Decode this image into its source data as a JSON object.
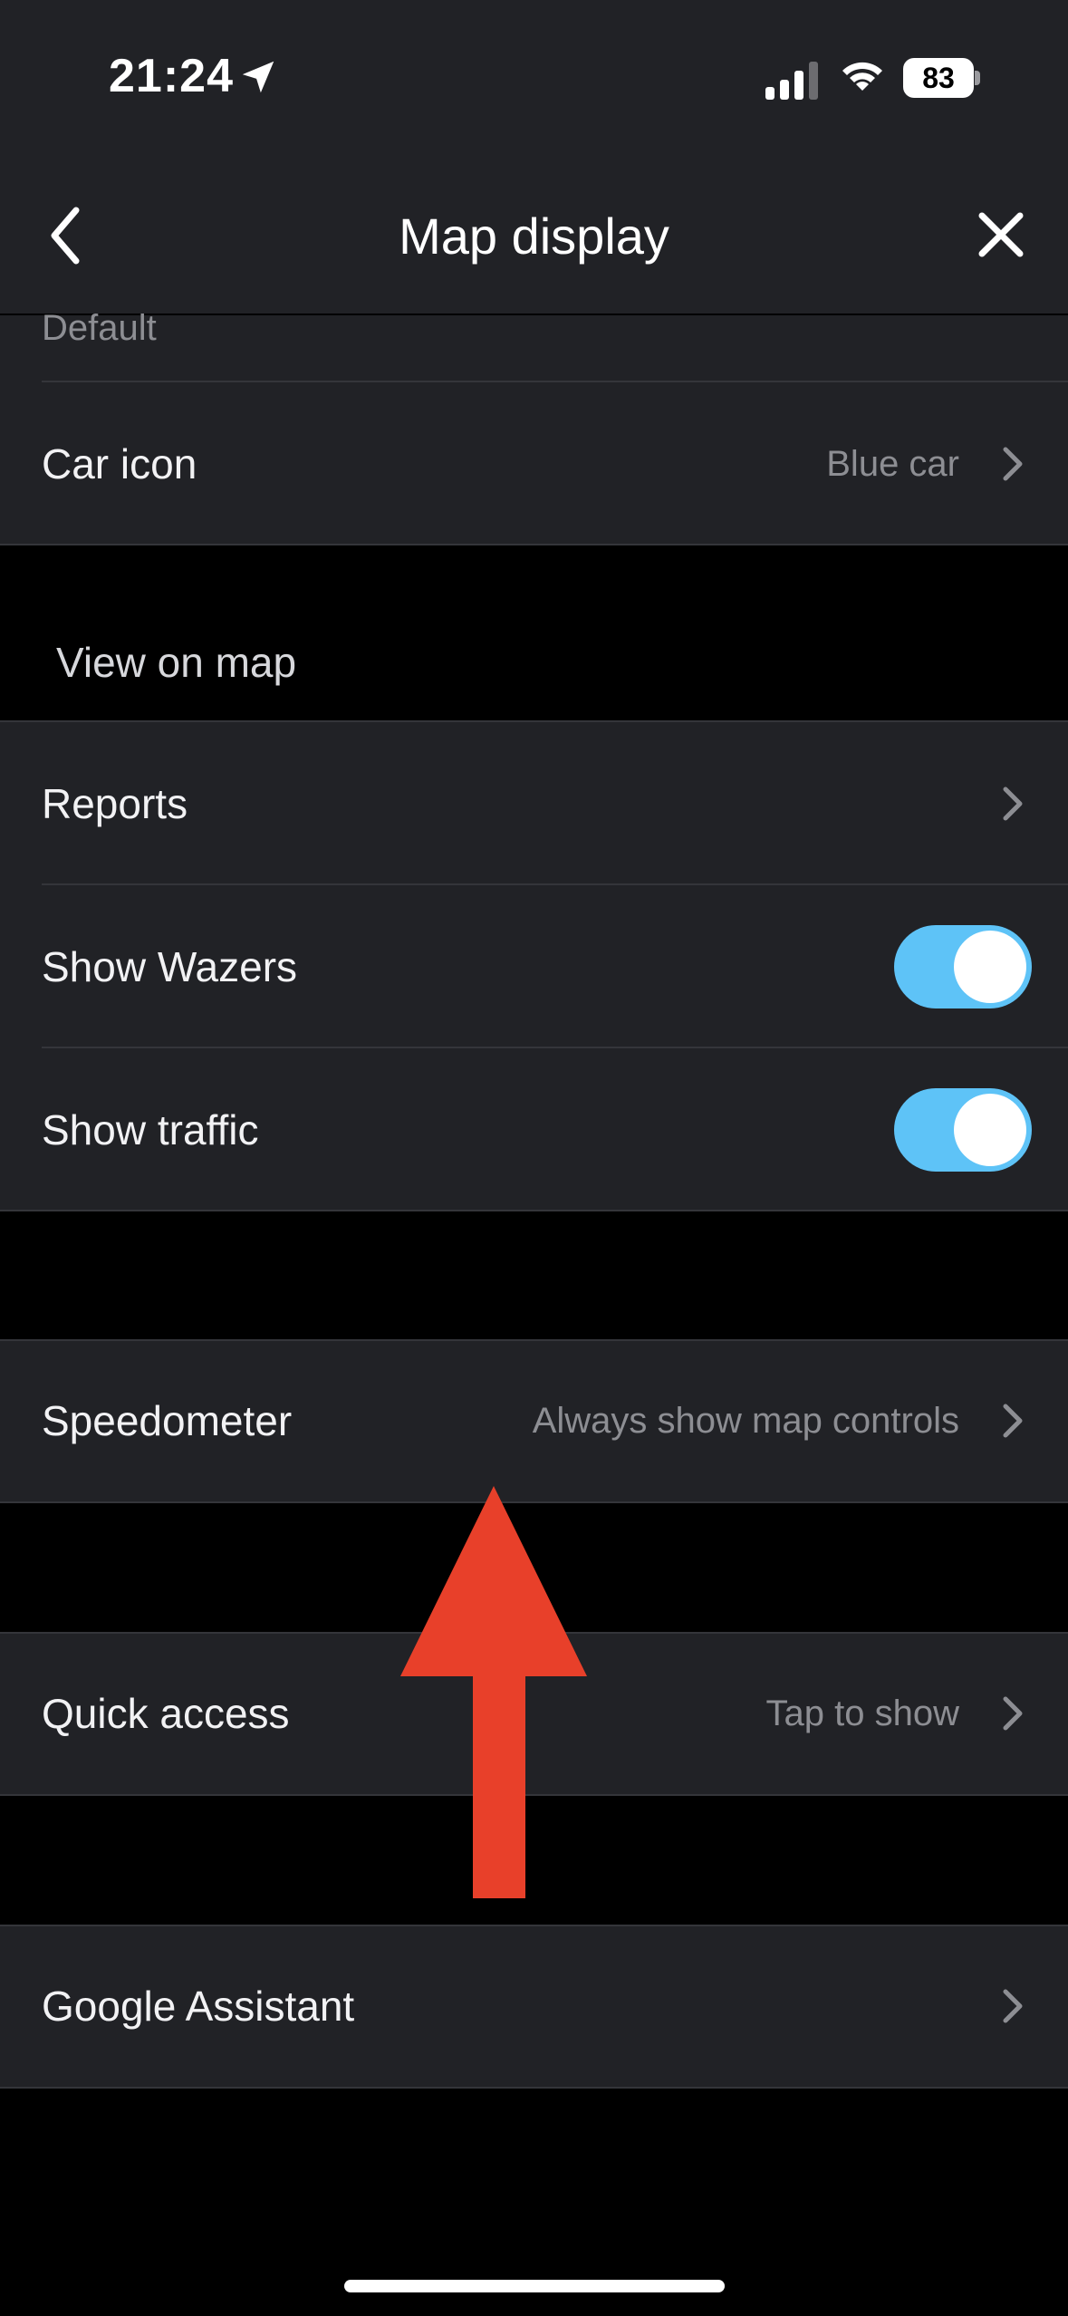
{
  "status_bar": {
    "time": "21:24",
    "battery_level": "83",
    "icons": [
      "location-arrow-icon",
      "signal-icon",
      "wifi-icon",
      "battery-icon"
    ]
  },
  "nav": {
    "title": "Map display",
    "back_icon": "chevron-left-icon",
    "close_icon": "close-icon"
  },
  "top_group": {
    "partial_label": "Default",
    "car_icon": {
      "label": "Car icon",
      "value": "Blue car"
    }
  },
  "view_on_map": {
    "header": "View on map",
    "reports": {
      "label": "Reports"
    },
    "show_wazers": {
      "label": "Show Wazers",
      "enabled": true
    },
    "show_traffic": {
      "label": "Show traffic",
      "enabled": true
    }
  },
  "speedometer": {
    "label": "Speedometer",
    "value": "Always show map controls"
  },
  "quick_access": {
    "label": "Quick access",
    "value": "Tap to show"
  },
  "google_assistant": {
    "label": "Google Assistant"
  },
  "colors": {
    "background": "#000000",
    "card": "#212226",
    "toggle_on": "#5ec3f7",
    "annotation_arrow": "#e8402a",
    "secondary_text": "#8d8e93"
  }
}
